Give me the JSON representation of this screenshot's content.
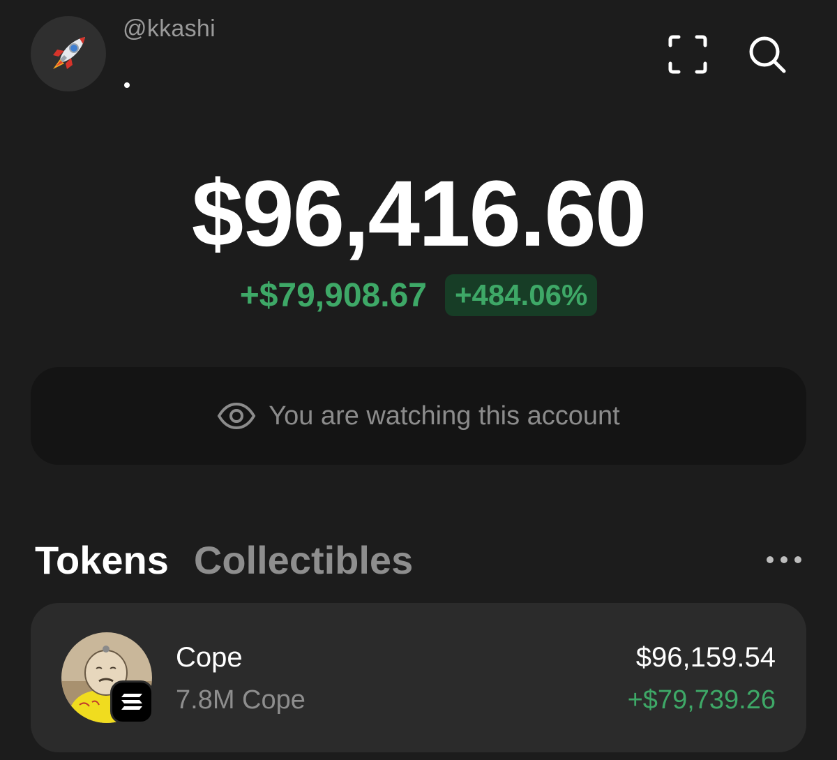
{
  "header": {
    "avatar_icon": "rocket-icon",
    "username": "@kkashi",
    "scan_icon": "scan-icon",
    "search_icon": "search-icon"
  },
  "balance": {
    "total": "$96,416.60",
    "change_amount": "+$79,908.67",
    "change_percent": "+484.06%"
  },
  "watch_banner": {
    "icon": "eye-icon",
    "text": "You are watching this account"
  },
  "tabs": [
    {
      "label": "Tokens",
      "active": true
    },
    {
      "label": "Collectibles",
      "active": false
    }
  ],
  "more_icon": "more-dots-icon",
  "tokens": [
    {
      "name": "Cope",
      "amount": "7.8M Cope",
      "value": "$96,159.54",
      "change": "+$79,739.26",
      "chain_icon": "solana-icon"
    }
  ],
  "colors": {
    "background": "#1c1c1c",
    "positive": "#3ea867",
    "positive_bg": "#173d26",
    "card": "#2b2b2b",
    "muted_text": "#8e8e8e"
  }
}
